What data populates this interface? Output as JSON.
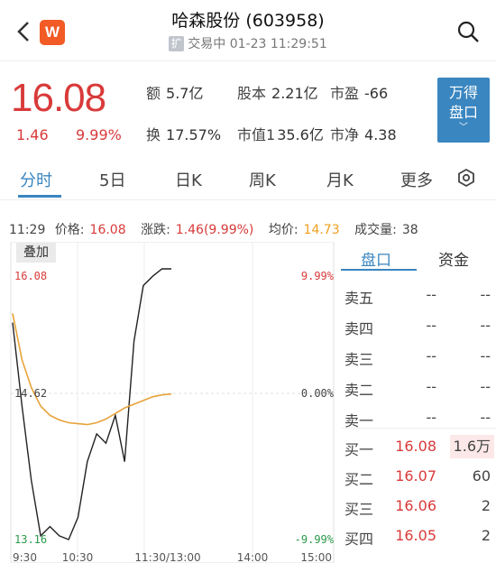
{
  "header": {
    "title": "哈森股份 (603958)",
    "badge": "扩",
    "status": "交易中 01-23 11:29:51",
    "brand_letter": "W"
  },
  "quote": {
    "price": "16.08",
    "change": "1.46",
    "change_pct": "9.99%",
    "stats": [
      {
        "label": "额",
        "value": "5.7亿"
      },
      {
        "label": "股本",
        "value": "2.21亿"
      },
      {
        "label": "市盈",
        "value": "-66"
      },
      {
        "label": "换",
        "value": "17.57%"
      },
      {
        "label": "市值1",
        "value": "35.6亿"
      },
      {
        "label": "市净",
        "value": "4.38"
      }
    ],
    "wd_button": {
      "line1": "万得",
      "line2": "盘口",
      "chevron": "﹀"
    }
  },
  "tabs": [
    "分时",
    "5日",
    "日K",
    "周K",
    "月K",
    "更多"
  ],
  "info": {
    "time": "11:29",
    "price_label": "价格:",
    "price": "16.08",
    "chg_label": "涨跌:",
    "chg": "1.46(9.99%)",
    "avg_label": "均价:",
    "avg": "14.73",
    "vol_label": "成交量:",
    "vol": "38"
  },
  "chart": {
    "overlay_label": "叠加",
    "y_left_top": "16.08",
    "y_left_mid": "14.62",
    "y_left_bottom": "13.16",
    "y_right_top": "9.99%",
    "y_right_mid": "0.00%",
    "y_right_bottom": "-9.99%",
    "x_ticks": [
      "9:30",
      "10:30",
      "11:30/13:00",
      "14:00",
      "15:00"
    ],
    "colors": {
      "price": "#222222",
      "avg": "#e8a23a",
      "up": "#d93a3a",
      "down": "#2a9a4a"
    }
  },
  "chart_data": {
    "type": "line",
    "ylim": [
      13.16,
      16.08
    ],
    "series": [
      {
        "values": [
          15.5,
          14.6,
          13.8,
          13.2,
          13.3,
          13.2,
          13.16,
          13.4,
          14.0,
          14.3,
          14.2,
          14.5,
          14.0,
          15.3,
          15.9,
          16.0,
          16.08,
          16.08
        ]
      },
      {
        "values": [
          15.6,
          15.1,
          14.8,
          14.6,
          14.5,
          14.45,
          14.42,
          14.41,
          14.4,
          14.42,
          14.46,
          14.52,
          14.58,
          14.62,
          14.66,
          14.7,
          14.72,
          14.73
        ]
      }
    ]
  },
  "book": {
    "tabs": [
      "盘口",
      "资金"
    ],
    "sells": [
      {
        "name": "卖五",
        "price": "--",
        "vol": "--"
      },
      {
        "name": "卖四",
        "price": "--",
        "vol": "--"
      },
      {
        "name": "卖三",
        "price": "--",
        "vol": "--"
      },
      {
        "name": "卖二",
        "price": "--",
        "vol": "--"
      },
      {
        "name": "卖一",
        "price": "--",
        "vol": "--"
      }
    ],
    "buys": [
      {
        "name": "买一",
        "price": "16.08",
        "vol": "1.6万"
      },
      {
        "name": "买二",
        "price": "16.07",
        "vol": "60"
      },
      {
        "name": "买三",
        "price": "16.06",
        "vol": "2"
      },
      {
        "name": "买四",
        "price": "16.05",
        "vol": "2"
      }
    ]
  }
}
